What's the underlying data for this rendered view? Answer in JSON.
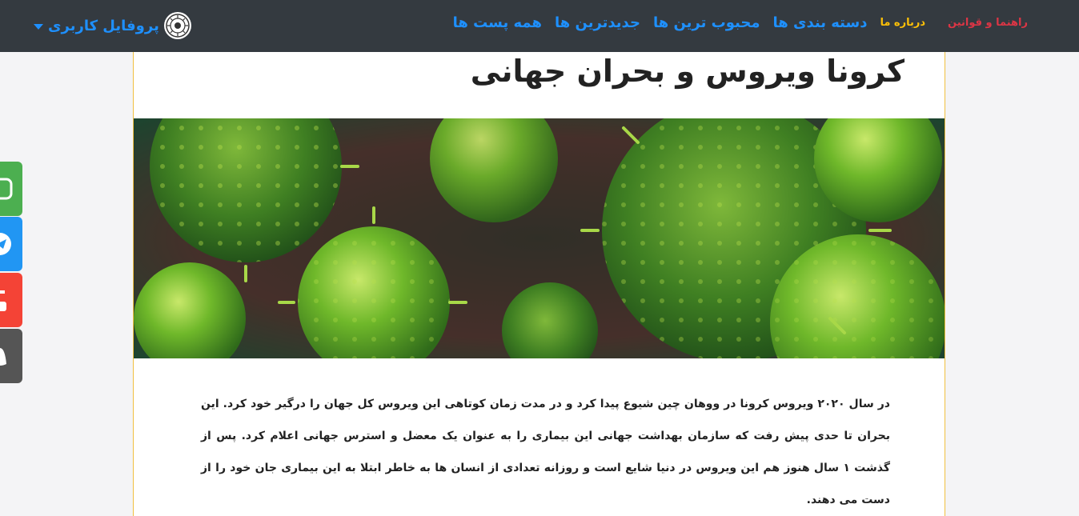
{
  "nav": {
    "links": [
      {
        "label": "همه پست ها",
        "color": "#1e90ff"
      },
      {
        "label": "جدیدترین ها",
        "color": "#1e90ff"
      },
      {
        "label": "محبوب ترین ها",
        "color": "#1e90ff"
      },
      {
        "label": "دسته بندی ها",
        "color": "#1e90ff"
      },
      {
        "label": "درباره ما",
        "color": "#ffc107"
      },
      {
        "label": "راهنما و قوانین",
        "color": "#dc3545"
      }
    ],
    "profile_label": "پروفایل کاربری",
    "background": "#343a40"
  },
  "social": [
    {
      "icon": "instagram-icon",
      "color": "#4caf50"
    },
    {
      "icon": "telegram-icon",
      "color": "#2196f3"
    },
    {
      "icon": "youtube-icon",
      "color": "#f44336"
    },
    {
      "icon": "snapchat-icon",
      "color": "#555555"
    }
  ],
  "post": {
    "title": "کرونا ویروس و بحران جهانی",
    "body": "در سال ۲۰۲۰ ویروس کرونا در ووهان چین شیوع پیدا کرد و در مدت زمان کوتاهی این ویروس کل جهان را درگیر خود کرد. این بحران تا حدی پیش رفت که سازمان بهداشت جهانی این بیماری را به عنوان یک معضل و استرس جهانی اعلام کرد. پس از گذشت ۱ سال هنوز هم این ویروس در دنیا شایع است و روزانه تعدادی از انسان ها به خاطر ابتلا به این بیماری جان خود را از دست می دهند."
  }
}
